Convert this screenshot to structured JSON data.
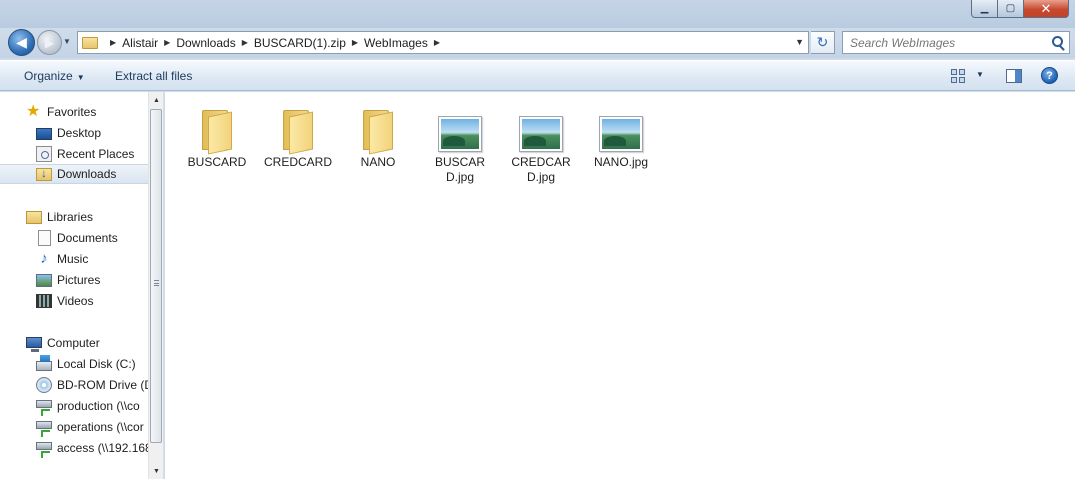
{
  "window": {
    "controls": {
      "minimize": "▁",
      "maximize": "▢",
      "close": "✕"
    }
  },
  "address": {
    "breadcrumbs": [
      "Alistair",
      "Downloads",
      "BUSCARD(1).zip",
      "WebImages"
    ],
    "search_placeholder": "Search WebImages"
  },
  "toolbar": {
    "organize_label": "Organize",
    "extract_label": "Extract all files"
  },
  "nav": {
    "favorites": {
      "label": "Favorites",
      "items": [
        {
          "label": "Desktop",
          "icon": "desktop-icon"
        },
        {
          "label": "Recent Places",
          "icon": "recent-places-icon"
        },
        {
          "label": "Downloads",
          "icon": "downloads-folder-icon",
          "selected": true
        }
      ]
    },
    "libraries": {
      "label": "Libraries",
      "items": [
        {
          "label": "Documents",
          "icon": "documents-icon"
        },
        {
          "label": "Music",
          "icon": "music-icon"
        },
        {
          "label": "Pictures",
          "icon": "pictures-icon"
        },
        {
          "label": "Videos",
          "icon": "videos-icon"
        }
      ]
    },
    "computer": {
      "label": "Computer",
      "items": [
        {
          "label": "Local Disk (C:)",
          "icon": "local-disk-icon"
        },
        {
          "label": "BD-ROM Drive (D",
          "icon": "bd-rom-icon"
        },
        {
          "label": "production (\\\\co",
          "icon": "network-drive-icon"
        },
        {
          "label": "operations (\\\\cor",
          "icon": "network-drive-icon"
        },
        {
          "label": "access (\\\\192.168",
          "icon": "network-drive-icon"
        }
      ]
    }
  },
  "files": [
    {
      "name": "BUSCARD",
      "type": "folder"
    },
    {
      "name": "CREDCARD",
      "type": "folder"
    },
    {
      "name": "NANO",
      "type": "folder"
    },
    {
      "name": "BUSCARD.jpg",
      "type": "image"
    },
    {
      "name": "CREDCARD.jpg",
      "type": "image"
    },
    {
      "name": "NANO.jpg",
      "type": "image"
    }
  ]
}
